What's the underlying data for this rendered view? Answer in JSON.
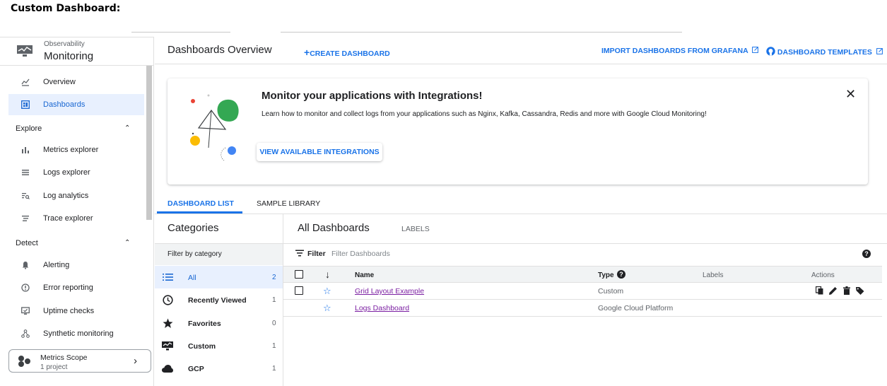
{
  "doc": {
    "title": "Custom Dashboard:"
  },
  "brand": {
    "subtitle": "Observability",
    "name": "Monitoring"
  },
  "sidebar": {
    "items": [
      {
        "label": "Overview",
        "icon": "overview-icon"
      },
      {
        "label": "Dashboards",
        "icon": "dashboards-icon",
        "active": true
      }
    ],
    "sections": [
      {
        "title": "Explore",
        "items": [
          {
            "label": "Metrics explorer",
            "icon": "bar-chart-icon"
          },
          {
            "label": "Logs explorer",
            "icon": "list-icon"
          },
          {
            "label": "Log analytics",
            "icon": "log-analytics-icon"
          },
          {
            "label": "Trace explorer",
            "icon": "trace-icon"
          }
        ]
      },
      {
        "title": "Detect",
        "items": [
          {
            "label": "Alerting",
            "icon": "bell-icon"
          },
          {
            "label": "Error reporting",
            "icon": "error-reporting-icon"
          },
          {
            "label": "Uptime checks",
            "icon": "uptime-icon"
          },
          {
            "label": "Synthetic monitoring",
            "icon": "synthetic-icon"
          }
        ]
      }
    ],
    "scope": {
      "title": "Metrics Scope",
      "subtitle": "1 project"
    }
  },
  "header": {
    "title": "Dashboards Overview",
    "create": "CREATE DASHBOARD",
    "import": "IMPORT DASHBOARDS FROM GRAFANA",
    "templates": "DASHBOARD TEMPLATES"
  },
  "banner": {
    "title": "Monitor your applications with Integrations!",
    "description": "Learn how to monitor and collect logs from your applications such as Nginx, Kafka, Cassandra, Redis and more with Google Cloud Monitoring!",
    "cta": "VIEW AVAILABLE INTEGRATIONS",
    "close": "✕"
  },
  "tabs": [
    "DASHBOARD LIST",
    "SAMPLE LIBRARY"
  ],
  "categories": {
    "title": "Categories",
    "filter_label": "Filter by category",
    "items": [
      {
        "label": "All",
        "count": "2",
        "icon": "list-icon"
      },
      {
        "label": "Recently Viewed",
        "count": "1",
        "icon": "clock-icon"
      },
      {
        "label": "Favorites",
        "count": "0",
        "icon": "star-icon"
      },
      {
        "label": "Custom",
        "count": "1",
        "icon": "monitor-icon"
      },
      {
        "label": "GCP",
        "count": "1",
        "icon": "cloud-icon"
      }
    ]
  },
  "dashboards": {
    "title": "All Dashboards",
    "labels_tab": "LABELS",
    "filter_label": "Filter",
    "filter_placeholder": "Filter Dashboards",
    "columns": {
      "sort": "↓",
      "name": "Name",
      "type": "Type",
      "labels": "Labels",
      "actions": "Actions"
    },
    "rows": [
      {
        "name": "Grid Layout Example",
        "type": "Custom"
      },
      {
        "name": "Logs Dashboard",
        "type": "Google Cloud Platform"
      }
    ]
  },
  "colors": {
    "accent": "#1a73e8",
    "active_bg": "#e8f0fe",
    "link_visited": "#7b1fa2"
  }
}
